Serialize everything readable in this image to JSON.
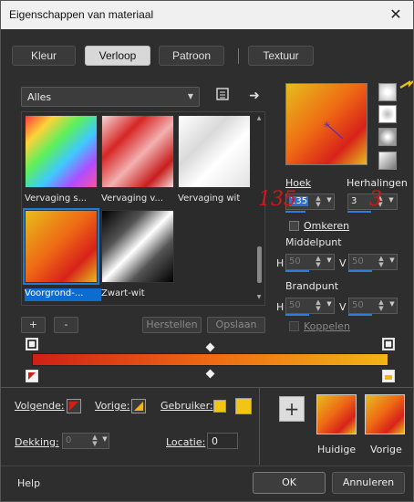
{
  "window": {
    "title": "Eigenschappen van materiaal"
  },
  "tabs": [
    {
      "label": "Kleur",
      "active": false
    },
    {
      "label": "Verloop",
      "active": true
    },
    {
      "label": "Patroon",
      "active": false
    },
    {
      "label": "Textuur",
      "active": false
    }
  ],
  "gallery": {
    "category": "Alles",
    "items": [
      {
        "caption": "Vervaging s..."
      },
      {
        "caption": "Vervaging v..."
      },
      {
        "caption": "Vervaging wit"
      },
      {
        "caption": "Voorgrond-...",
        "selected": true
      },
      {
        "caption": "Zwart-wit"
      }
    ],
    "add_label": "+",
    "remove_label": "-",
    "reset_label": "Herstellen",
    "save_label": "Opslaan"
  },
  "params": {
    "angle_label": "Hoek",
    "angle_value": "135",
    "repeats_label": "Herhalingen",
    "repeats_value": "3",
    "angle_annotation": "135",
    "repeats_annotation": "3",
    "invert_label": "Omkeren",
    "center_label": "Middelpunt",
    "center_h_label": "H",
    "center_h": "50",
    "center_v_label": "V",
    "center_v": "50",
    "focal_label": "Brandpunt",
    "focal_h_label": "H",
    "focal_h": "50",
    "focal_v_label": "V",
    "focal_v": "50",
    "link_label": "Koppelen"
  },
  "bottom": {
    "next_label": "Volgende:",
    "prev_label": "Vorige:",
    "user_label": "Gebruiker:",
    "opacity_label": "Dekking:",
    "opacity_value": "0",
    "location_label": "Locatie:",
    "location_value": "0",
    "current_label": "Huidige",
    "previous_label": "Vorige",
    "plus_label": "+"
  },
  "footer": {
    "help": "Help",
    "ok": "OK",
    "cancel": "Annuleren"
  },
  "colors": {
    "accent": "#1f7ad8",
    "gradient_start": "#cf2016",
    "gradient_mid": "#ee6a14",
    "gradient_end": "#f2b516",
    "annotation_red": "#d21818"
  }
}
